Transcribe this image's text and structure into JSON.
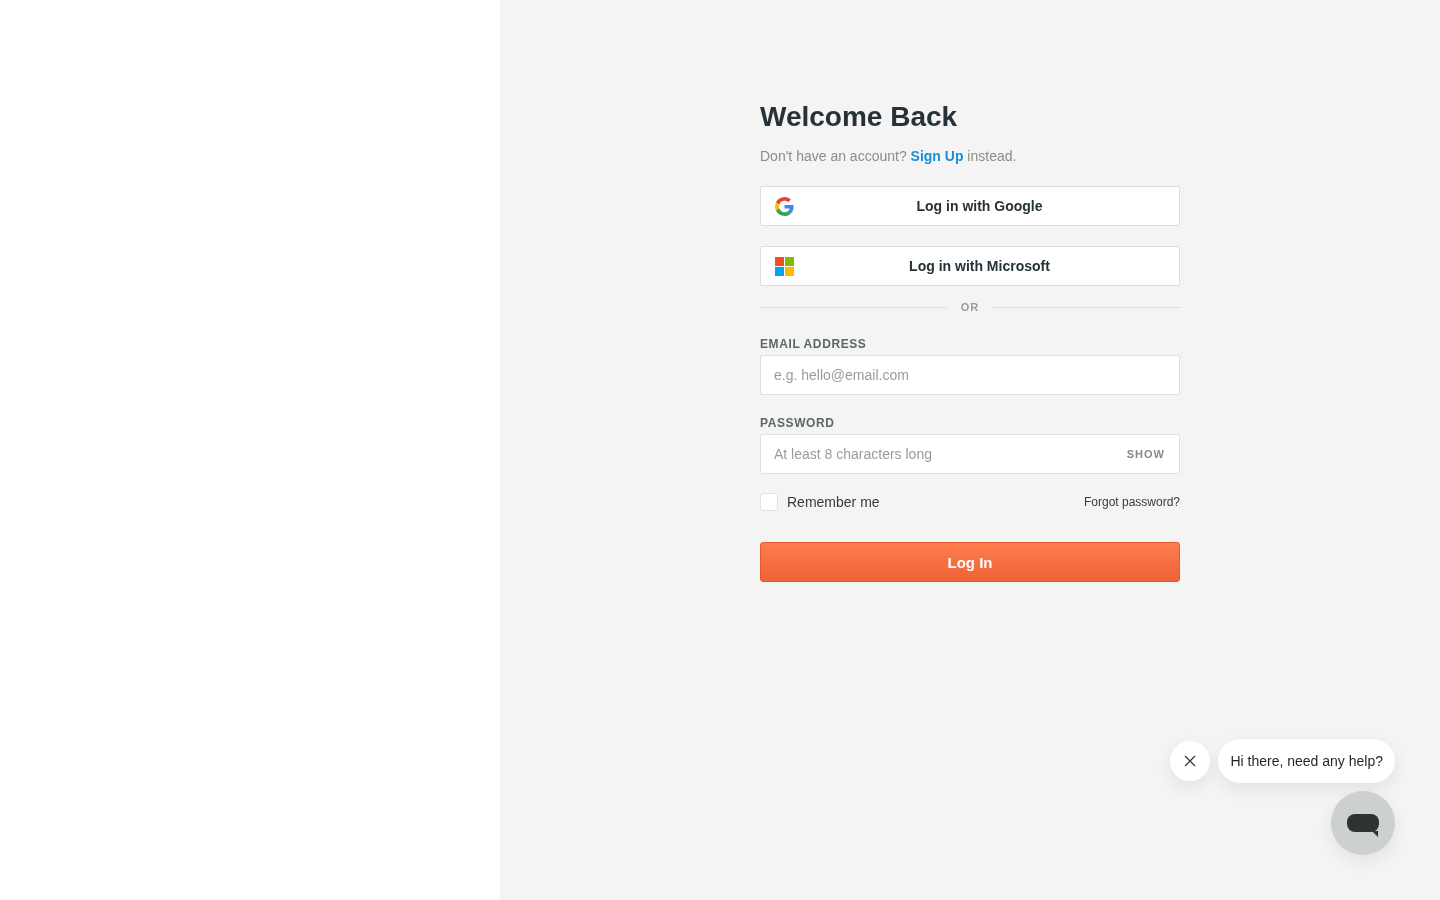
{
  "heading": "Welcome Back",
  "signup_prompt": {
    "text": "Don't have an account?",
    "link": "Sign Up",
    "suffix": "instead."
  },
  "social_buttons": [
    {
      "kind": "google",
      "label": "Log in with Google"
    },
    {
      "kind": "microsoft",
      "label": "Log in with Microsoft"
    }
  ],
  "divider": "OR",
  "fields": [
    {
      "kind": "email",
      "label": "EMAIL ADDRESS",
      "placeholder": "e.g. hello@email.com"
    },
    {
      "kind": "password",
      "label": "PASSWORD",
      "placeholder": "At least 8 characters long",
      "toggle": "SHOW"
    }
  ],
  "remember": {
    "label": "Remember me",
    "checked": false
  },
  "forgot_link": "Forgot password?",
  "submit": "Log In",
  "chat": {
    "greeting": "Hi there, need any help?"
  }
}
